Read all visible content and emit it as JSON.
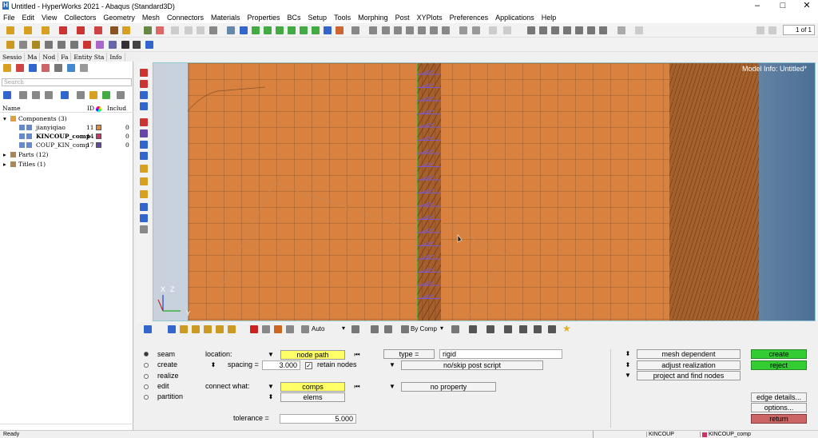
{
  "window": {
    "title": "Untitled - HyperWorks 2021 - Abaqus (Standard3D)",
    "minimize": "–",
    "maximize": "□",
    "close": "✕"
  },
  "menu": [
    "File",
    "Edit",
    "View",
    "Collectors",
    "Geometry",
    "Mesh",
    "Connectors",
    "Materials",
    "Properties",
    "BCs",
    "Setup",
    "Tools",
    "Morphing",
    "Post",
    "XYPlots",
    "Preferences",
    "Applications",
    "Help"
  ],
  "page_counter": "1 of 1",
  "left_panel": {
    "tabs": [
      "Sessio",
      "Ma",
      "Nod",
      "Fa",
      "Entity Sta",
      "Info"
    ],
    "search_placeholder": "Search",
    "columns": {
      "name": "Name",
      "id": "ID",
      "include": "Includ"
    },
    "tree": [
      {
        "label": "Components (3)",
        "id": "",
        "inc": "",
        "color": ""
      },
      {
        "label": "jianyiqiao",
        "id": "11",
        "inc": "0",
        "color": "#e08a3a"
      },
      {
        "label": "KINCOUP_comp",
        "id": "14",
        "inc": "0",
        "color": "#cc3366"
      },
      {
        "label": "COUP_KIN_comp",
        "id": "17",
        "inc": "0",
        "color": "#6644aa"
      },
      {
        "label": "Parts (12)",
        "id": "",
        "inc": "",
        "color": ""
      },
      {
        "label": "Titles (1)",
        "id": "",
        "inc": "",
        "color": ""
      }
    ]
  },
  "viewport": {
    "model_info": "Model Info: Untitled*",
    "axis_x": "X",
    "axis_z": "Z",
    "axis_y": "Y"
  },
  "viewport_toolbar": {
    "auto": "Auto",
    "by_comp": "By Comp"
  },
  "panel": {
    "radios": [
      {
        "label": "seam",
        "selected": true
      },
      {
        "label": "create",
        "selected": false
      },
      {
        "label": "realize",
        "selected": false
      },
      {
        "label": "edit",
        "selected": false
      },
      {
        "label": "partition",
        "selected": false
      }
    ],
    "location_label": "location:",
    "location_value": "node path",
    "spacing_label": "spacing =",
    "spacing_value": "3.000",
    "retain_label": "retain nodes",
    "connect_label": "connect what:",
    "comps": "comps",
    "elems": "elems",
    "tolerance_label": "tolerance =",
    "tolerance_value": "5.000",
    "type_label": "type =",
    "type_value": "rigid",
    "post_script": "no/skip post script",
    "no_property": "no property",
    "mesh_dependent": "mesh dependent",
    "adjust_realization": "adjust realization",
    "project_find": "project and find nodes",
    "create": "create",
    "reject": "reject",
    "edge_details": "edge details...",
    "options": "options...",
    "return": "return"
  },
  "status": {
    "ready": "Ready",
    "comp1": "KINCOUP",
    "comp2": "KINCOUP_comp"
  },
  "colors": {
    "mesh": "#d9823f",
    "mesh_dark": "#b5652d",
    "yellow": "#ffff66",
    "green": "#33cc33",
    "red": "#cc6666",
    "purple": "#7a5ad0"
  }
}
